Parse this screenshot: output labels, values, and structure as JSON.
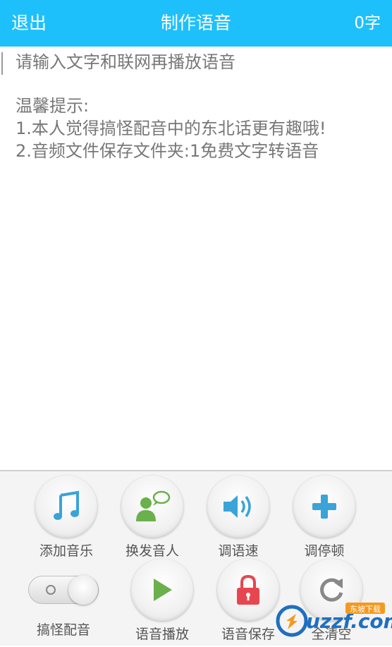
{
  "header": {
    "back_label": "退出",
    "title": "制作语音",
    "char_count": "0字"
  },
  "editor": {
    "placeholder": "请输入文字和联网再播放语音",
    "tips": [
      "温馨提示:",
      "1.本人觉得搞怪配音中的东北话更有趣哦!",
      "2.音频文件保存文件夹:1免费文字转语音"
    ]
  },
  "toolbar": {
    "row1": [
      {
        "label": "添加音乐",
        "icon": "music-note-icon"
      },
      {
        "label": "换发音人",
        "icon": "speaker-person-icon"
      },
      {
        "label": "调语速",
        "icon": "volume-icon"
      },
      {
        "label": "调停顿",
        "icon": "plus-icon"
      }
    ],
    "row2": [
      {
        "label": "搞怪配音",
        "icon": "toggle-switch",
        "state": "off"
      },
      {
        "label": "语音播放",
        "icon": "play-icon"
      },
      {
        "label": "语音保存",
        "icon": "lock-icon"
      },
      {
        "label": "全清空",
        "icon": "refresh-icon"
      }
    ]
  },
  "watermark": {
    "text": "uzzf.com",
    "tag": "东坡下载"
  },
  "colors": {
    "header_bg": "#1ec0fb",
    "icon_blue": "#3aa3d8",
    "icon_green": "#6ab04c",
    "icon_red": "#e8464e",
    "icon_gray": "#888888"
  }
}
